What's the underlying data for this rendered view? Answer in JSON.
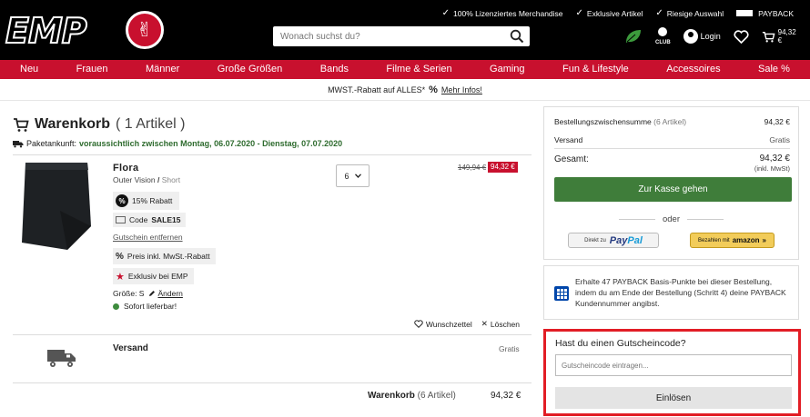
{
  "header": {
    "logo": "EMP",
    "usps": [
      "100% Lizenziertes Merchandise",
      "Exklusive Artikel",
      "Riesige Auswahl",
      "PAYBACK"
    ],
    "search_placeholder": "Wonach suchst du?",
    "club_label": "CLUB",
    "login_label": "Login",
    "cart_total": "94,32 €"
  },
  "nav": [
    "Neu",
    "Frauen",
    "Männer",
    "Große Größen",
    "Bands",
    "Filme & Serien",
    "Gaming",
    "Fun & Lifestyle",
    "Accessoires",
    "Sale %"
  ],
  "notice": {
    "text": "MWST.-Rabatt auf ALLES*",
    "symbol": "%",
    "link": "Mehr Infos!"
  },
  "cart": {
    "title": "Warenkorb",
    "count": "( 1 Artikel )",
    "delivery_label": "Paketankunft:",
    "delivery_value": "voraussichtlich zwischen Montag, 06.07.2020 - Dienstag, 07.07.2020",
    "item": {
      "name": "Flora",
      "brand": "Outer Vision",
      "separator": "/",
      "category": "Short",
      "discount_symbol": "%",
      "discount_label": "15% Rabatt",
      "code_prefix": "Code",
      "code": "SALE15",
      "remove_voucher": "Gutschein entfernen",
      "vat_tag": "Preis inkl. MwSt.-Rabatt",
      "exclusive_tag": "Exklusiv bei EMP",
      "size_label": "Größe: S",
      "change_label": "Ändern",
      "stock": "Sofort lieferbar!",
      "quantity": "6",
      "old_price": "149,94 €",
      "new_price": "94,32 €",
      "wishlist_label": "Wunschzettel",
      "delete_label": "Löschen"
    },
    "shipping_label": "Versand",
    "shipping_value": "Gratis",
    "subtotal_label": "Warenkorb",
    "subtotal_count": "(6 Artikel)",
    "subtotal_value": "94,32 €"
  },
  "summary": {
    "subtotal_label": "Bestellungszwischensumme",
    "subtotal_count": "(6 Artikel)",
    "subtotal_value": "94,32 €",
    "shipping_label": "Versand",
    "shipping_value": "Gratis",
    "total_label": "Gesamt:",
    "total_value": "94,32 €",
    "total_note": "(inkl. MwSt)",
    "checkout_label": "Zur Kasse gehen",
    "or_label": "oder",
    "paypal_prefix": "Direkt zu",
    "paypal_brand_a": "Pay",
    "paypal_brand_b": "Pal",
    "amazon_prefix": "Bezahlen mit",
    "amazon_brand": "amazon"
  },
  "payback": {
    "text": "Erhalte 47 PAYBACK Basis-Punkte bei dieser Bestellung, indem du am Ende der Bestellung (Schritt 4) deine PAYBACK Kundennummer angibst."
  },
  "voucher": {
    "title": "Hast du einen Gutscheincode?",
    "placeholder": "Gutscheincode eintragen...",
    "button": "Einlösen"
  },
  "colors": {
    "brand_red": "#c8102e",
    "checkout_green": "#3f7d3a",
    "highlight_red": "#e21d25"
  }
}
